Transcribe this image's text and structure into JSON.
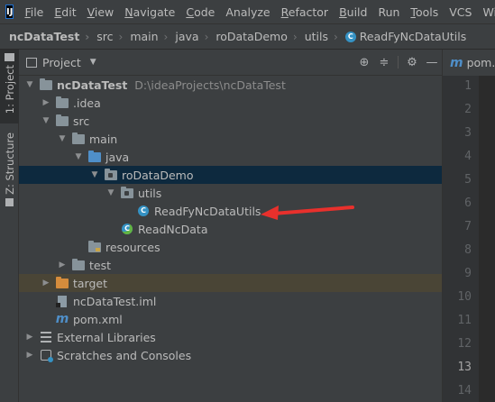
{
  "menu": {
    "logo": "IJ",
    "items": [
      {
        "label": "File",
        "underline": "F",
        "rest": "ile"
      },
      {
        "label": "Edit",
        "underline": "E",
        "rest": "dit"
      },
      {
        "label": "View",
        "underline": "V",
        "rest": "iew"
      },
      {
        "label": "Navigate",
        "underline": "N",
        "rest": "avigate"
      },
      {
        "label": "Code",
        "underline": "C",
        "rest": "ode"
      },
      {
        "label": "Analyze",
        "underline": "",
        "rest": "Analyze"
      },
      {
        "label": "Refactor",
        "underline": "R",
        "rest": "efactor"
      },
      {
        "label": "Build",
        "underline": "B",
        "rest": "uild"
      },
      {
        "label": "Run",
        "underline": "",
        "rest": "Run"
      },
      {
        "label": "Tools",
        "underline": "T",
        "rest": "ools"
      },
      {
        "label": "VCS",
        "underline": "",
        "rest": "VCS"
      },
      {
        "label": "Win",
        "underline": "",
        "rest": "Win"
      }
    ]
  },
  "breadcrumb": [
    "ncDataTest",
    "src",
    "main",
    "java",
    "roDataDemo",
    "utils",
    "ReadFyNcDataUtils"
  ],
  "side_tabs": {
    "project": "1: Project",
    "structure": "Z: Structure"
  },
  "panel": {
    "title": "Project"
  },
  "tree": {
    "root": "ncDataTest",
    "root_path": "D:\\ideaProjects\\ncDataTest",
    "idea": ".idea",
    "src": "src",
    "main": "main",
    "java": "java",
    "package": "roDataDemo",
    "utils": "utils",
    "class1": "ReadFyNcDataUtils",
    "class2": "ReadNcData",
    "resources": "resources",
    "test": "test",
    "target": "target",
    "iml": "ncDataTest.iml",
    "pom": "pom.xml",
    "libraries": "External Libraries",
    "scratches": "Scratches and Consoles"
  },
  "editor": {
    "tab_label": "pom.",
    "line_numbers": [
      "1",
      "2",
      "3",
      "4",
      "5",
      "6",
      "7",
      "8",
      "9",
      "10",
      "11",
      "12",
      "13",
      "14"
    ],
    "current_line": "13"
  },
  "colors": {
    "selection": "#0d293e",
    "excluded": "#4a4536",
    "annotation_arrow": "#e8302c",
    "class_icon": "#3592c4"
  }
}
